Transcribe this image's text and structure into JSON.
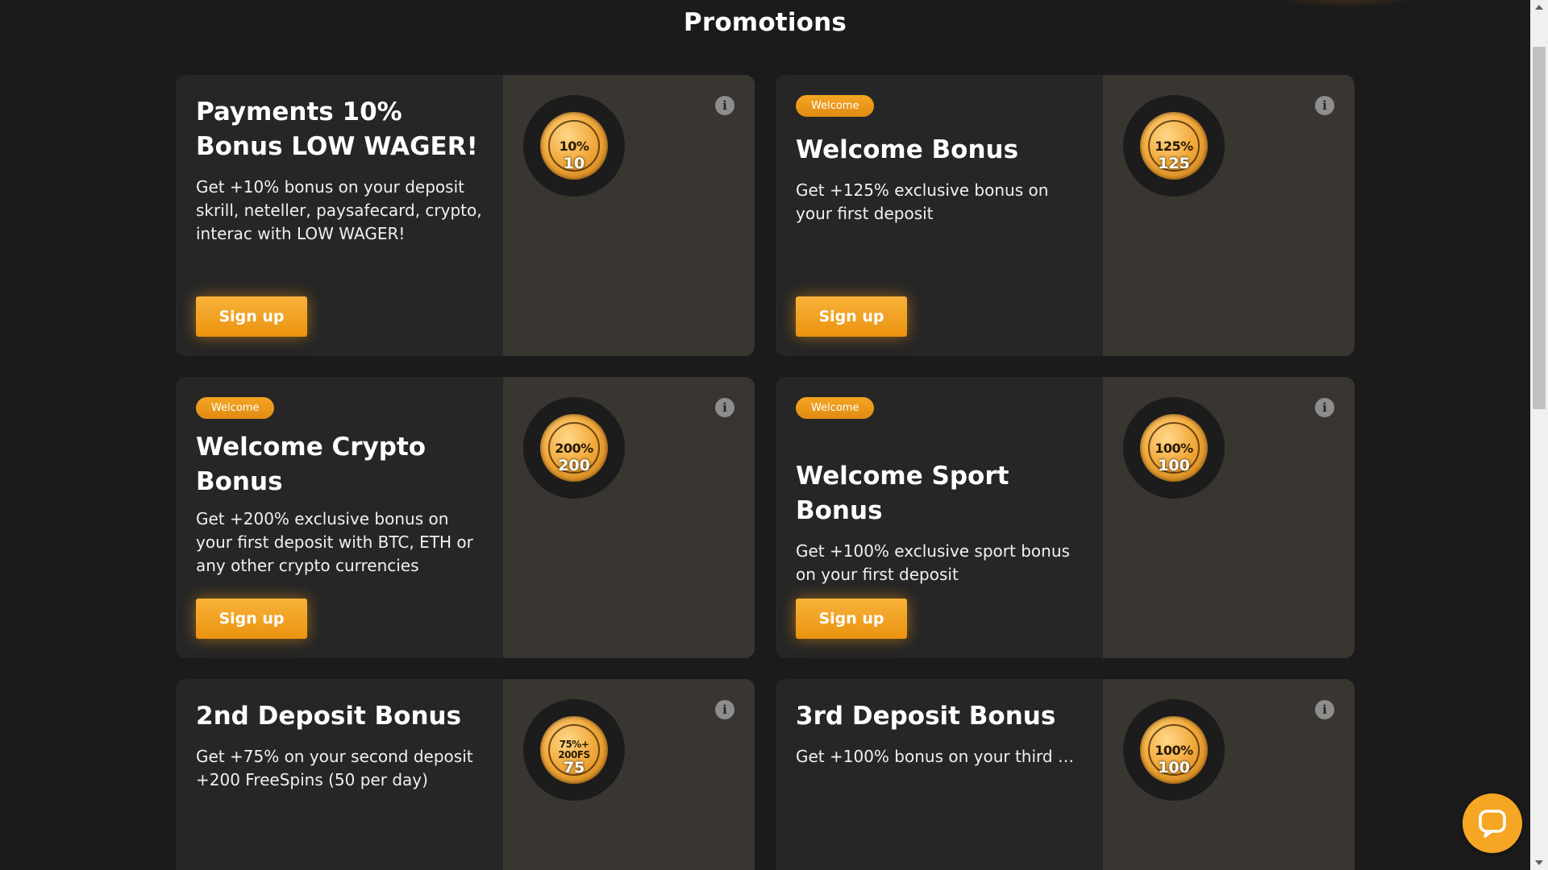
{
  "page": {
    "title": "Promotions"
  },
  "colors": {
    "accent": "#f5a623",
    "background": "#1b1b1b",
    "card_left": "#262626",
    "card_right": "#393631"
  },
  "promotions": [
    {
      "badge": "",
      "title": "Payments 10% Bonus LOW WAGER!",
      "description": "Get +10% bonus on your deposit skrill, neteller, paysafecard, crypto, interac with LOW WAGER!",
      "button": "Sign up",
      "coin_label": "10%",
      "coin_value": "10",
      "info_icon": "info-icon"
    },
    {
      "badge": "Welcome",
      "title": "Welcome Bonus",
      "description": "Get +125% exclusive bonus on your first deposit",
      "button": "Sign up",
      "coin_label": "125%",
      "coin_value": "125",
      "info_icon": "info-icon"
    },
    {
      "badge": "Welcome",
      "title": "Welcome Crypto Bonus",
      "description": "Get +200% exclusive bonus on your first deposit with BTC, ETH or any other crypto currencies",
      "button": "Sign up",
      "coin_label": "200%",
      "coin_value": "200",
      "info_icon": "info-icon"
    },
    {
      "badge": "Welcome",
      "title": "Welcome Sport Bonus",
      "description": "Get +100% exclusive sport bonus on your first deposit",
      "button": "Sign up",
      "coin_label": "100%",
      "coin_value": "100",
      "info_icon": "info-icon"
    },
    {
      "badge": "",
      "title": "2nd Deposit Bonus",
      "description": "Get +75% on your second deposit +200 FreeSpins (50 per day)",
      "button": "",
      "coin_label": "75%+ 200FS",
      "coin_value": "75",
      "info_icon": "info-icon"
    },
    {
      "badge": "",
      "title": "3rd Deposit Bonus",
      "description": "Get +100% bonus on your third de...",
      "button": "",
      "coin_label": "100%",
      "coin_value": "100",
      "info_icon": "info-icon"
    }
  ],
  "chat": {
    "icon": "chat-bubble-icon"
  }
}
